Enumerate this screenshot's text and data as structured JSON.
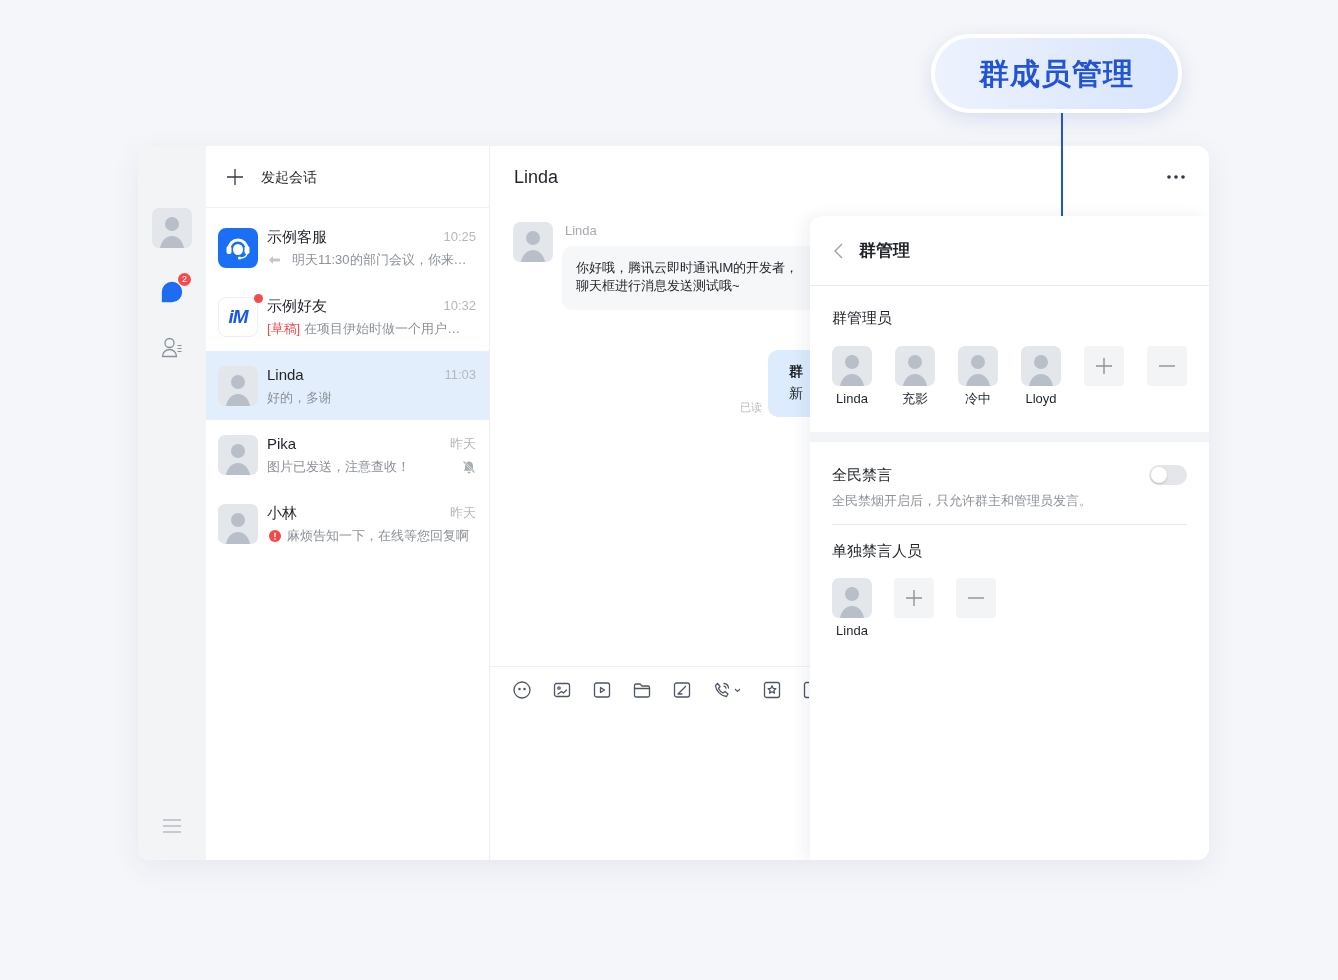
{
  "callout": {
    "label": "群成员管理"
  },
  "rail": {
    "nav": [
      {
        "kind": "chat",
        "selected": true,
        "badge": "2"
      },
      {
        "kind": "contacts",
        "selected": false
      }
    ]
  },
  "conversation_list": {
    "new_chat": "发起会话",
    "items": [
      {
        "name": "示例客服",
        "time": "10:25",
        "kind": "service",
        "replied": true,
        "preview": "明天11:30的部门会议，你来…",
        "selected": false,
        "unread_dot": false,
        "muted": false,
        "send_failed": false
      },
      {
        "name": "示例好友",
        "time": "10:32",
        "kind": "logo",
        "logo_text": "iM",
        "draft_tag": "[草稿]",
        "replied": false,
        "preview": "在项目伊始时做一个用户…",
        "selected": false,
        "unread_dot": true,
        "muted": false,
        "send_failed": false
      },
      {
        "name": "Linda",
        "time": "11:03",
        "kind": "photo",
        "replied": false,
        "preview": "好的，多谢",
        "selected": true,
        "unread_dot": false,
        "muted": false,
        "send_failed": false
      },
      {
        "name": "Pika",
        "time": "昨天",
        "kind": "photo",
        "replied": false,
        "preview": "图片已发送，注意查收！",
        "selected": false,
        "unread_dot": false,
        "muted": true,
        "send_failed": false
      },
      {
        "name": "小林",
        "time": "昨天",
        "kind": "photo",
        "replied": false,
        "preview": "麻烦告知一下，在线等您回复啊",
        "selected": false,
        "unread_dot": false,
        "muted": false,
        "send_failed": true
      }
    ]
  },
  "chat": {
    "title": "Linda",
    "messages": [
      {
        "kind": "received",
        "sender": "Linda",
        "lines": [
          "你好哦，腾讯云即时通讯IM的开发者，",
          "聊天框进行消息发送测试哦~"
        ]
      },
      {
        "kind": "sent",
        "title": "群",
        "lines": [
          "新"
        ],
        "status": "已读"
      }
    ]
  },
  "group_admin_panel": {
    "title": "群管理",
    "admins": {
      "label": "群管理员",
      "members": [
        {
          "name": "Linda"
        },
        {
          "name": "充影"
        },
        {
          "name": "冷中"
        },
        {
          "name": "Lloyd"
        }
      ]
    },
    "mute_all": {
      "label": "全民禁言",
      "on": false,
      "description": "全民禁烟开启后，只允许群主和管理员发言。"
    },
    "muted_members": {
      "label": "单独禁言人员",
      "members": [
        {
          "name": "Linda"
        }
      ]
    }
  }
}
